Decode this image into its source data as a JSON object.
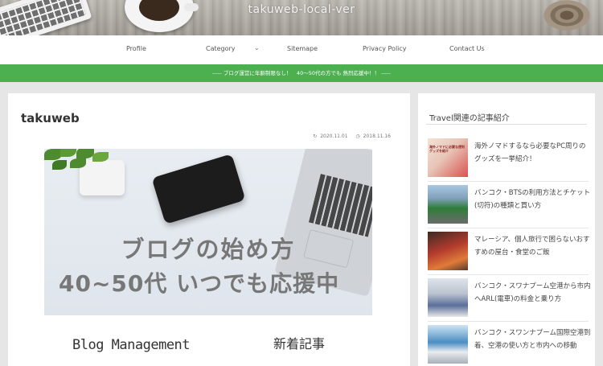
{
  "header": {
    "site_title": "takuweb-local-ver"
  },
  "nav": {
    "items": [
      {
        "label": "Profile"
      },
      {
        "label": "Category"
      },
      {
        "label": "Sitemape"
      },
      {
        "label": "Privacy Policy"
      },
      {
        "label": "Contact Us"
      }
    ],
    "chevron": "⌄"
  },
  "notice": {
    "text": "----- ブログ運営に年齢制限なし！　40〜50代の方でも 熱烈応援中！！ -----"
  },
  "article": {
    "title": "takuweb",
    "updated": "2020.11.01",
    "published": "2018.11.16",
    "updated_icon": "↻",
    "published_icon": "◷",
    "thumbnail": {
      "line1": "ブログの始め方",
      "line2": "40~50代 いつでも応援中"
    },
    "sub_left": "Blog Management",
    "sub_right": "新着記事"
  },
  "sidebar": {
    "heading": "Travel関連の記事紹介",
    "items": [
      {
        "label": "海外ノマドするなら必要なPC周りのグッズを一挙紹介！",
        "thumb_color": "#d9534f",
        "thumb_caption": "海外ノマドに必要な便利グッズを紹介"
      },
      {
        "label": "バンコク・BTSの利用方法とチケット(切符)の種類と買い方",
        "thumb_color": "#2f7d39"
      },
      {
        "label": "マレーシア、個人旅行で困らないおすすめの屋台・食堂のご飯",
        "thumb_color": "#b33b2e"
      },
      {
        "label": "バンコク・スワナプーム空港から市内へARL(電車)の料金と乗り方",
        "thumb_color": "#5a6e9a"
      },
      {
        "label": "バンコク・スワンナプーム国際空港到着、空港の使い方と市内への移動",
        "thumb_color": "#4a8ec2"
      }
    ]
  },
  "colors": {
    "accent_green": "#4caf50",
    "background": "#e6e6e6"
  }
}
